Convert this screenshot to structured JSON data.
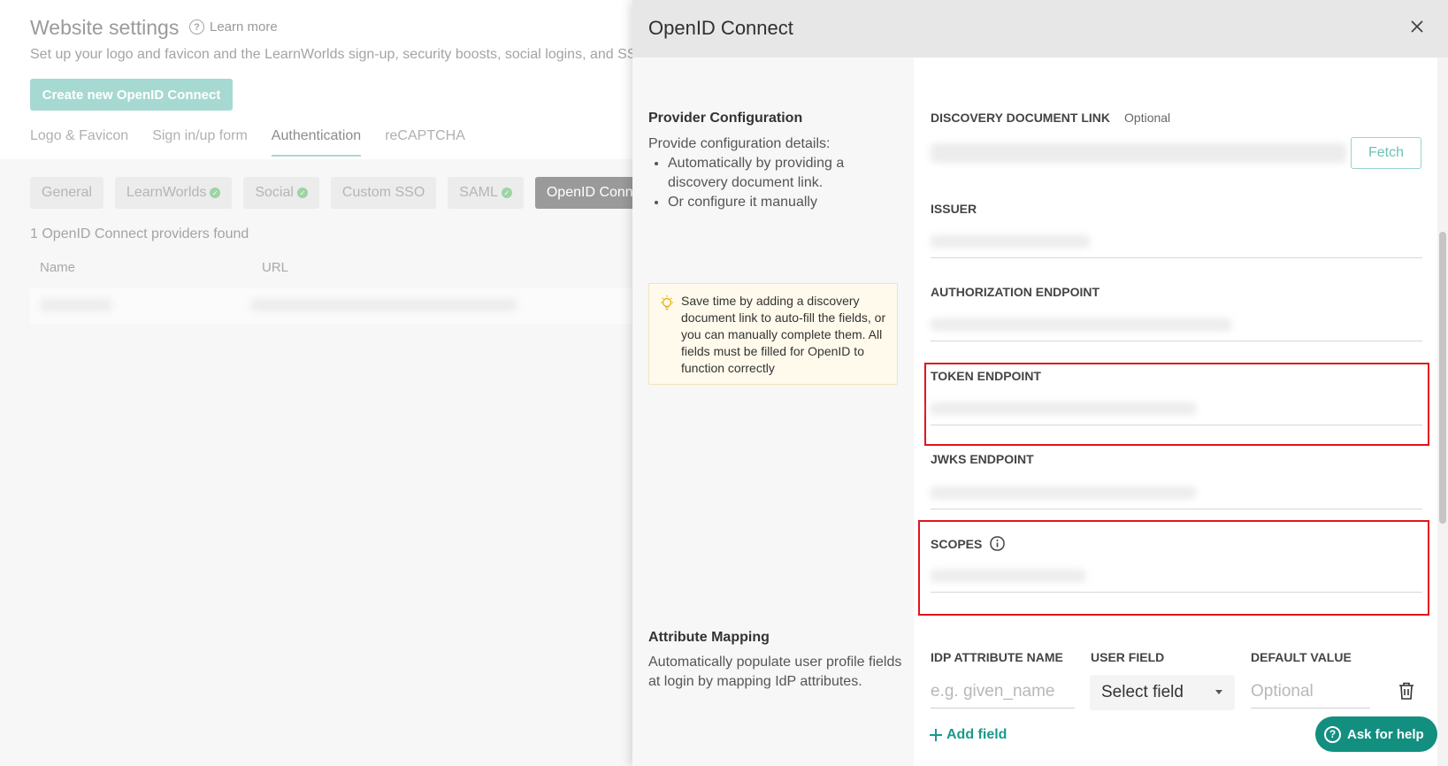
{
  "background": {
    "title": "Website settings",
    "learn_more": "Learn more",
    "subtitle": "Set up your logo and favicon and the LearnWorlds sign-up, security boosts, social logins, and SSO.",
    "create_button": "Create new OpenID Connect",
    "tabs": [
      "Logo & Favicon",
      "Sign in/up form",
      "Authentication",
      "reCAPTCHA"
    ],
    "active_tab": "Authentication",
    "pills": [
      {
        "label": "General",
        "check": false
      },
      {
        "label": "LearnWorlds",
        "check": true
      },
      {
        "label": "Social",
        "check": true
      },
      {
        "label": "Custom SSO",
        "check": false
      },
      {
        "label": "SAML",
        "check": true
      },
      {
        "label": "OpenID Conne",
        "check": false
      }
    ],
    "found_text": "1 OpenID Connect providers found",
    "table_headers": [
      "Name",
      "URL"
    ]
  },
  "drawer": {
    "title": "OpenID Connect",
    "provider": {
      "title": "Provider Configuration",
      "intro": "Provide configuration details:",
      "bullets": [
        "Automatically by providing a discovery document link.",
        "Or configure it manually"
      ],
      "tip": "Save time by adding a discovery document link to auto-fill the fields, or you can manually complete them. All fields must be filled for OpenID to function correctly"
    },
    "fields": {
      "discovery_label": "DISCOVERY DOCUMENT LINK",
      "discovery_optional": "Optional",
      "fetch_label": "Fetch",
      "issuer_label": "ISSUER",
      "authorization_label": "AUTHORIZATION ENDPOINT",
      "token_label": "TOKEN ENDPOINT",
      "jwks_label": "JWKS ENDPOINT",
      "scopes_label": "SCOPES"
    },
    "mapping": {
      "title": "Attribute Mapping",
      "desc": "Automatically populate user profile fields at login by mapping IdP attributes.",
      "col_idp": "IDP ATTRIBUTE NAME",
      "col_user": "USER FIELD",
      "col_default": "DEFAULT VALUE",
      "idp_placeholder": "e.g. given_name",
      "select_value": "Select field",
      "default_placeholder": "Optional",
      "add_field": "Add field"
    },
    "help_label": "Ask for help"
  },
  "colors": {
    "accent": "#1a9a8b",
    "highlight": "#e3141b",
    "tip_bg": "#fffaeb"
  }
}
